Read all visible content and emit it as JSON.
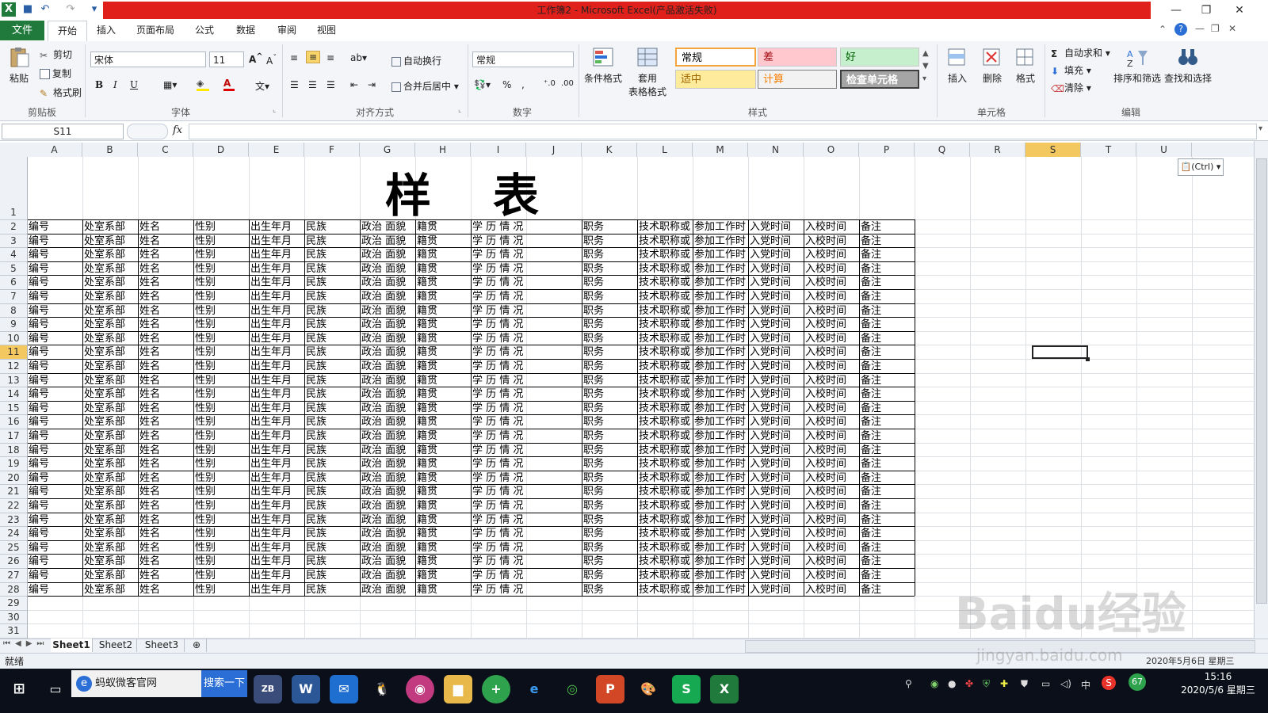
{
  "window": {
    "title": "工作簿2 - Microsoft Excel(产品激活失败)",
    "controls": [
      "—",
      "❐",
      "✕"
    ]
  },
  "tabs": {
    "file": "文件",
    "items": [
      "开始",
      "插入",
      "页面布局",
      "公式",
      "数据",
      "审阅",
      "视图"
    ],
    "active": "开始"
  },
  "ribbon": {
    "clipboard": {
      "paste": "粘贴",
      "cut": "剪切",
      "copy": "复制",
      "format_painter": "格式刷",
      "label": "剪贴板"
    },
    "font": {
      "name": "宋体",
      "size": "11",
      "label": "字体",
      "bold": "B",
      "italic": "I",
      "underline": "U"
    },
    "alignment": {
      "wrap": "自动换行",
      "merge": "合并后居中",
      "label": "对齐方式"
    },
    "number": {
      "format": "常规",
      "label": "数字"
    },
    "styles": {
      "conditional": "条件格式",
      "table_format_1": "套用",
      "table_format_2": "表格格式",
      "label": "样式",
      "cells": [
        {
          "text": "常规",
          "bg": "#ffffff",
          "fg": "#000000"
        },
        {
          "text": "差",
          "bg": "#ffc7ce",
          "fg": "#9c0006"
        },
        {
          "text": "好",
          "bg": "#c6efce",
          "fg": "#006100"
        },
        {
          "text": "适中",
          "bg": "#ffeb9c",
          "fg": "#9c6500"
        },
        {
          "text": "计算",
          "bg": "#f2f2f2",
          "fg": "#fa7d00"
        },
        {
          "text": "检查单元格",
          "bg": "#a5a5a5",
          "fg": "#ffffff"
        }
      ]
    },
    "cells": {
      "insert": "插入",
      "delete": "删除",
      "format": "格式",
      "label": "单元格"
    },
    "editing": {
      "autosum": "自动求和",
      "fill": "填充",
      "clear": "清除",
      "sort": "排序和筛选",
      "find": "查找和选择",
      "label": "编辑"
    }
  },
  "formula_bar": {
    "name_box": "S11",
    "fx": "fx",
    "value": ""
  },
  "grid": {
    "columns": [
      "A",
      "B",
      "C",
      "D",
      "E",
      "F",
      "G",
      "H",
      "I",
      "J",
      "K",
      "L",
      "M",
      "N",
      "O",
      "P",
      "Q",
      "R",
      "S",
      "T",
      "U"
    ],
    "selected_column": "S",
    "selected_row": 11,
    "rows": 31,
    "title": "样表",
    "header_values": [
      "编号",
      "处室系部",
      "姓名",
      "性别",
      "出生年月",
      "民族",
      "政治  面貌",
      "籍贯",
      "学  历  情  况",
      "",
      "职务",
      "技术职称或",
      "参加工作时",
      "入党时间",
      "入校时间",
      "备注"
    ],
    "paste_options": "(Ctrl)"
  },
  "sheets": {
    "tabs": [
      "Sheet1",
      "Sheet2",
      "Sheet3"
    ],
    "active": "Sheet1"
  },
  "status": {
    "text": "就绪"
  },
  "taskbar": {
    "search_text": "蚂蚁微客官网",
    "search_button": "搜索一下",
    "time": "15:16",
    "date": "2020/5/6 星期三",
    "ime": "中",
    "badge": "67"
  },
  "watermark": {
    "text": "Baidu经验",
    "url": "jingyan.baidu.com",
    "status_date": "2020年5月6日 星期三"
  }
}
